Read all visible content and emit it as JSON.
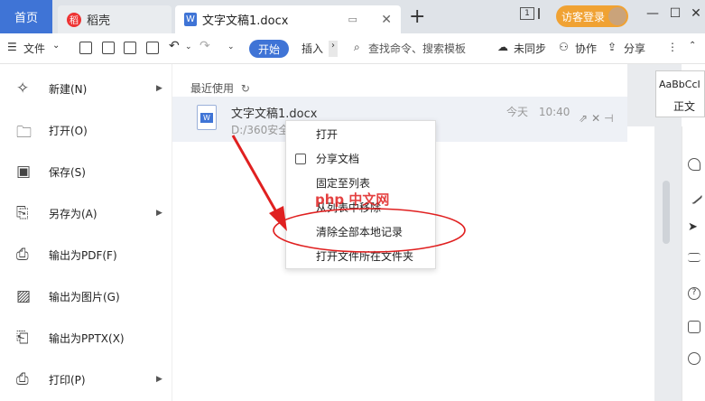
{
  "tabs": {
    "home": "首页",
    "daoke": "稻壳",
    "doc": "文字文稿1.docx",
    "new_tab": "+",
    "window_count": "1"
  },
  "account": {
    "login": "访客登录"
  },
  "toolbar": {
    "menu_label": "文件",
    "start": "开始",
    "insert": "插入",
    "search_placeholder": "查找命令、搜索模板",
    "sync": "未同步",
    "collab": "协作",
    "share": "分享"
  },
  "left_menu": [
    {
      "label": "新建(N)",
      "icon": "new-icon",
      "arrow": true
    },
    {
      "label": "打开(O)",
      "icon": "folder-icon",
      "arrow": false
    },
    {
      "label": "保存(S)",
      "icon": "save-icon",
      "arrow": false
    },
    {
      "label": "另存为(A)",
      "icon": "save-as-icon",
      "arrow": true
    },
    {
      "label": "输出为PDF(F)",
      "icon": "pdf-icon",
      "arrow": false
    },
    {
      "label": "输出为图片(G)",
      "icon": "image-icon",
      "arrow": false
    },
    {
      "label": "输出为PPTX(X)",
      "icon": "pptx-icon",
      "arrow": false
    },
    {
      "label": "打印(P)",
      "icon": "print-icon",
      "arrow": true
    }
  ],
  "recent": {
    "title": "最近使用",
    "file": {
      "name": "文字文稿1.docx",
      "path": "D:/360安全",
      "day": "今天",
      "time": "10:40"
    }
  },
  "context_menu": [
    {
      "label": "打开"
    },
    {
      "label": "分享文档"
    },
    {
      "label": "固定至列表"
    },
    {
      "label": "从列表中移除"
    },
    {
      "label": "清除全部本地记录"
    },
    {
      "label": "打开文件所在文件夹"
    }
  ],
  "style_panel": {
    "sample": "AaBbCcI",
    "name": "正文"
  },
  "watermark": "php 中文网",
  "colors": {
    "accent": "#3f74d6",
    "login": "#f0a233",
    "annotation": "#e02020"
  }
}
